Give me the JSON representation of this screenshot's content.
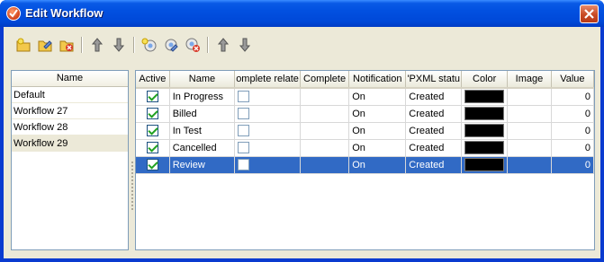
{
  "window": {
    "title": "Edit Workflow"
  },
  "workflows": {
    "header": "Name",
    "items": [
      "Default",
      "Workflow 27",
      "Workflow 28",
      "Workflow 29"
    ],
    "selected_index": 3
  },
  "grid": {
    "columns": [
      "Active",
      "Name",
      "omplete relate",
      "Complete",
      "Notification",
      "'PXML statu",
      "Color",
      "Image",
      "Value"
    ],
    "rows": [
      {
        "active": true,
        "name": "In Progress",
        "notification": "On",
        "pxml_status": "Created",
        "color": "#000000",
        "value": "0"
      },
      {
        "active": true,
        "name": "Billed",
        "notification": "On",
        "pxml_status": "Created",
        "color": "#000000",
        "value": "0"
      },
      {
        "active": true,
        "name": "In Test",
        "notification": "On",
        "pxml_status": "Created",
        "color": "#000000",
        "value": "0"
      },
      {
        "active": true,
        "name": "Cancelled",
        "notification": "On",
        "pxml_status": "Created",
        "color": "#000000",
        "value": "0"
      },
      {
        "active": true,
        "name": "Review",
        "notification": "On",
        "pxml_status": "Created",
        "color": "#000000",
        "value": "0"
      }
    ],
    "selected_index": 4
  },
  "toolbar": {
    "icons": [
      "add-workflow-icon",
      "edit-workflow-icon",
      "delete-workflow-icon",
      "move-up-icon",
      "move-down-icon",
      "add-status-icon",
      "edit-status-icon",
      "delete-status-icon",
      "move-status-up-icon",
      "move-status-down-icon"
    ]
  },
  "colors": {
    "selection": "#316ac5",
    "titlebar": "#0250e0",
    "face": "#ece9d8"
  }
}
